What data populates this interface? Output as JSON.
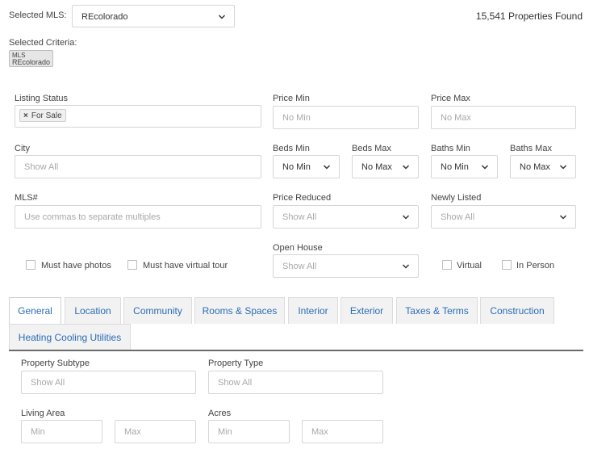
{
  "mls": {
    "label": "Selected MLS:",
    "value": "REcolorado",
    "count": "15,541 Properties Found"
  },
  "criteria": {
    "label": "Selected Criteria:",
    "chip_title": "MLS",
    "chip_value": "REcolorado"
  },
  "filters": {
    "listing_status": {
      "label": "Listing Status",
      "tag": "For Sale",
      "tag_remove": "×"
    },
    "price_min": {
      "label": "Price Min",
      "placeholder": "No Min"
    },
    "price_max": {
      "label": "Price Max",
      "placeholder": "No Max"
    },
    "city": {
      "label": "City",
      "placeholder": "Show All"
    },
    "beds_min": {
      "label": "Beds Min",
      "value": "No Min"
    },
    "beds_max": {
      "label": "Beds Max",
      "value": "No Max"
    },
    "baths_min": {
      "label": "Baths Min",
      "value": "No Min"
    },
    "baths_max": {
      "label": "Baths Max",
      "value": "No Max"
    },
    "mls_number": {
      "label": "MLS#",
      "placeholder": "Use commas to separate multiples"
    },
    "price_reduced": {
      "label": "Price Reduced",
      "value": "Show All"
    },
    "newly_listed": {
      "label": "Newly Listed",
      "value": "Show All"
    },
    "open_house": {
      "label": "Open House",
      "value": "Show All"
    }
  },
  "checkboxes": {
    "photos": "Must have photos",
    "virtual_tour": "Must have virtual tour",
    "virtual": "Virtual",
    "in_person": "In Person"
  },
  "tabs": [
    {
      "label": "General",
      "active": true
    },
    {
      "label": "Location"
    },
    {
      "label": "Community"
    },
    {
      "label": "Rooms & Spaces"
    },
    {
      "label": "Interior"
    },
    {
      "label": "Exterior"
    },
    {
      "label": "Taxes & Terms"
    },
    {
      "label": "Construction"
    },
    {
      "label": "Heating Cooling Utilities"
    }
  ],
  "general": {
    "property_subtype": {
      "label": "Property Subtype",
      "placeholder": "Show All"
    },
    "property_type": {
      "label": "Property Type",
      "placeholder": "Show All"
    },
    "living_area": {
      "label": "Living Area",
      "min": "Min",
      "max": "Max"
    },
    "acres": {
      "label": "Acres",
      "min": "Min",
      "max": "Max"
    }
  },
  "colors": {
    "tab_text": "#2b6cb5",
    "divider": "#6b6b6b"
  },
  "icons": {
    "dropdown": "chevron-down-icon",
    "remove": "close-icon"
  }
}
